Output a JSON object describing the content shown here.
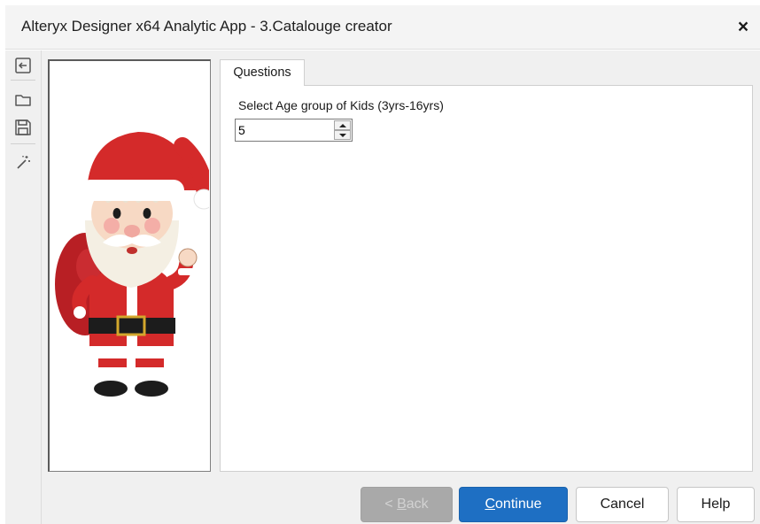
{
  "window": {
    "title": "Alteryx Designer x64 Analytic App - 3.Catalouge creator",
    "close_symbol": "×"
  },
  "toolbar": {
    "items": [
      {
        "name": "back-icon"
      },
      {
        "name": "open-folder-icon"
      },
      {
        "name": "save-icon"
      },
      {
        "name": "magic-wand-icon"
      }
    ]
  },
  "image_panel": {
    "image": "santa-claus-illustration"
  },
  "tabs": [
    {
      "label": "Questions",
      "active": true
    }
  ],
  "questions": {
    "age_group_label": "Select Age group of Kids (3yrs-16yrs)",
    "age_group_value": "5"
  },
  "buttons": {
    "back": {
      "prefix": "< ",
      "accel": "B",
      "rest": "ack",
      "enabled": false
    },
    "continue": {
      "accel": "C",
      "rest": "ontinue"
    },
    "cancel": "Cancel",
    "help": "Help"
  },
  "colors": {
    "primary": "#1e6fc3",
    "disabled": "#a9a9a9",
    "santa_red": "#d42a2a"
  }
}
